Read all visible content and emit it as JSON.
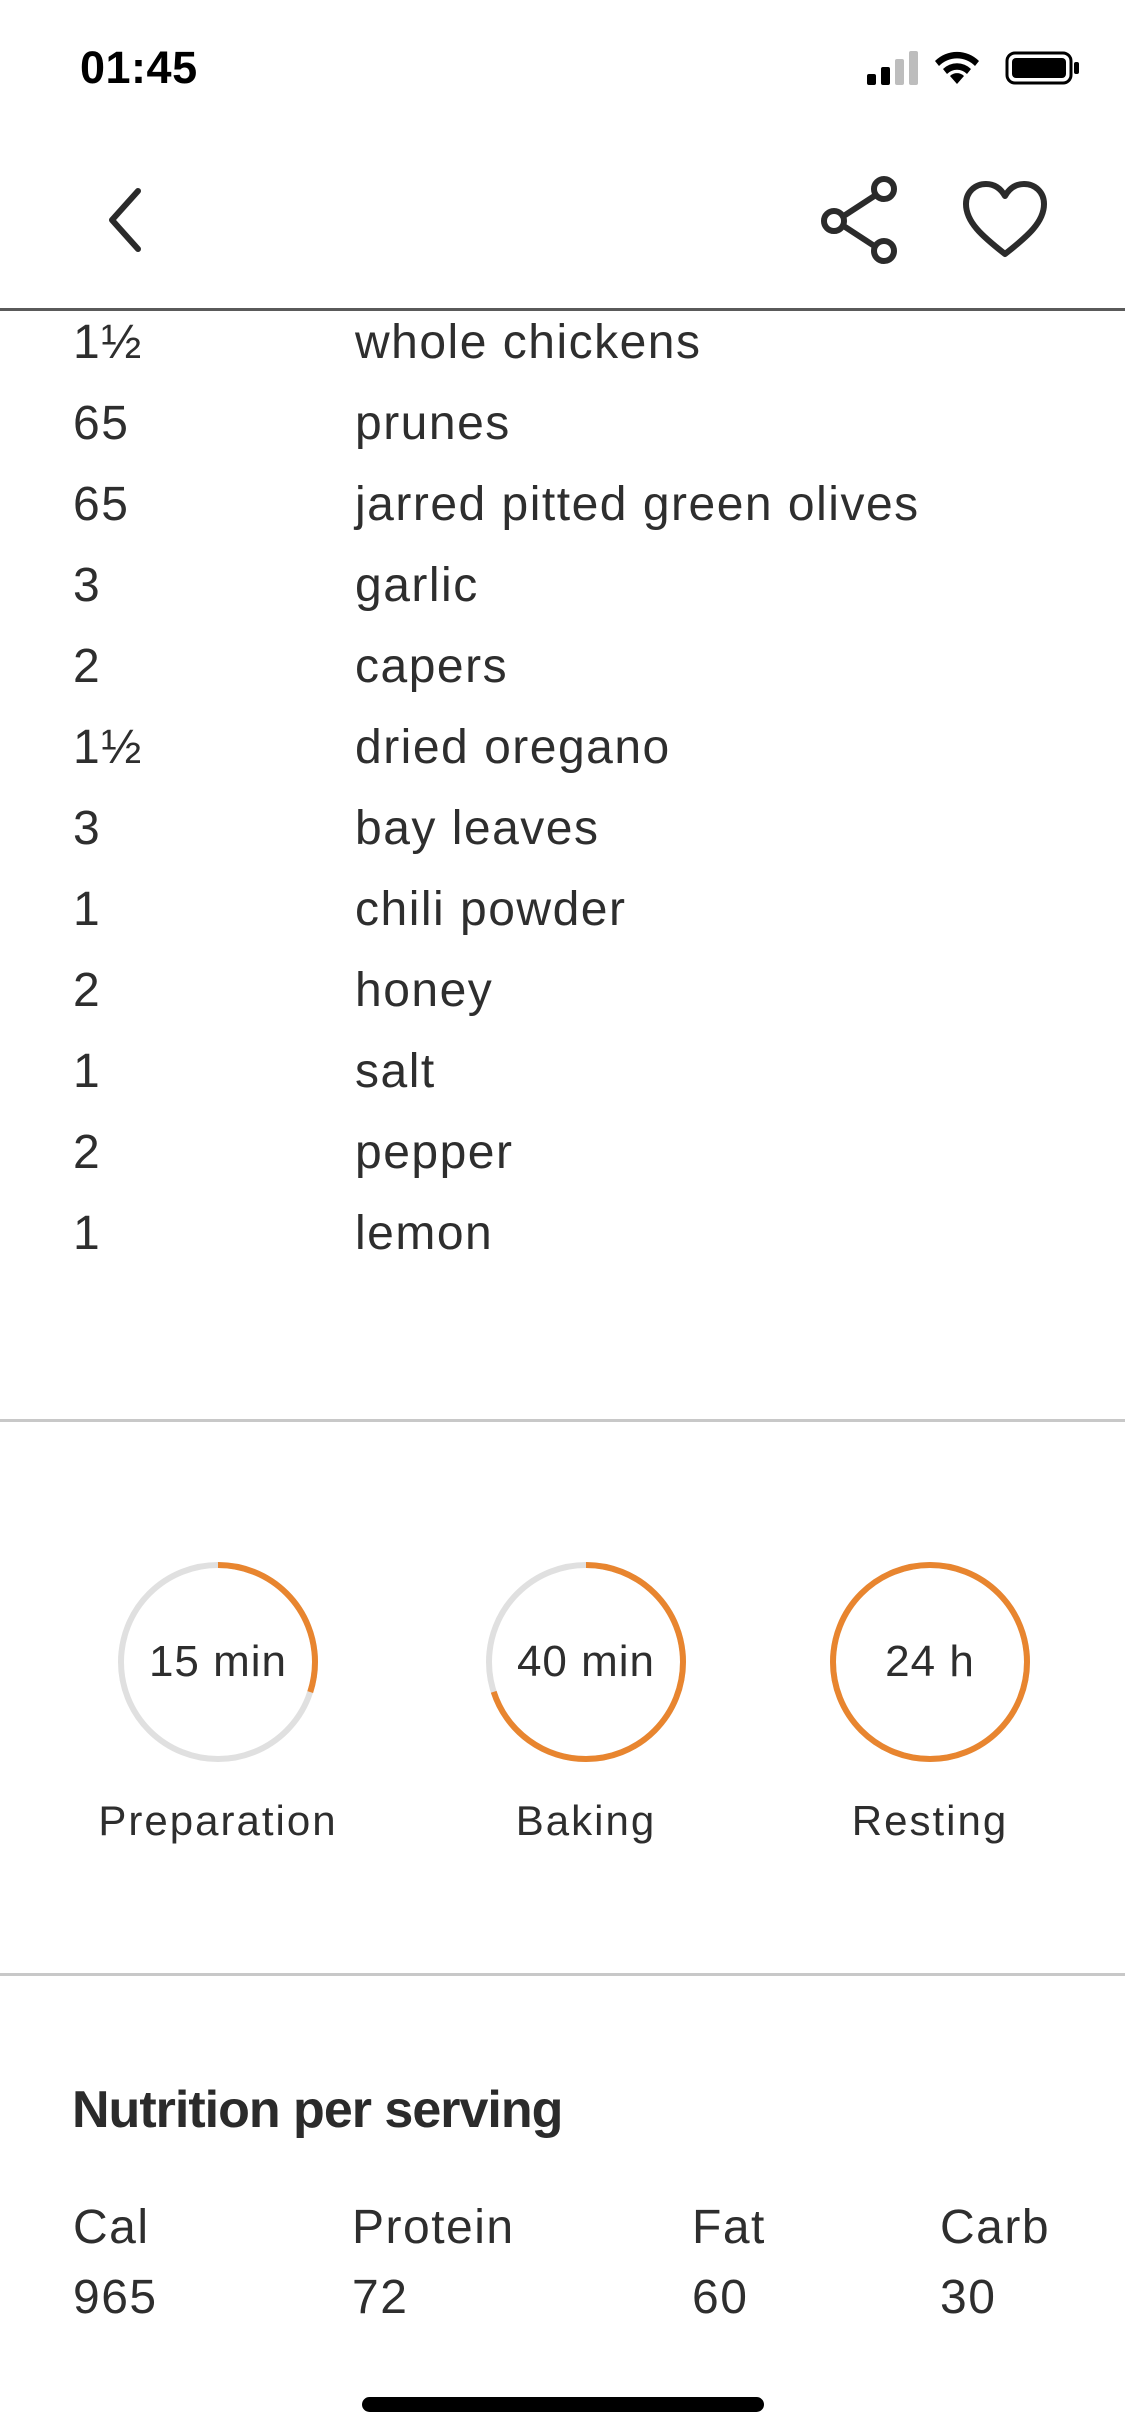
{
  "status_bar": {
    "time": "01:45"
  },
  "ingredients": [
    {
      "qty": "1½",
      "name": "whole chickens"
    },
    {
      "qty": "65",
      "name": "prunes"
    },
    {
      "qty": "65",
      "name": "jarred pitted green olives"
    },
    {
      "qty": "3",
      "name": "garlic"
    },
    {
      "qty": "2",
      "name": "capers"
    },
    {
      "qty": "1½",
      "name": "dried oregano"
    },
    {
      "qty": "3",
      "name": "bay leaves"
    },
    {
      "qty": "1",
      "name": "chili powder"
    },
    {
      "qty": "2",
      "name": "honey"
    },
    {
      "qty": "1",
      "name": "salt"
    },
    {
      "qty": "2",
      "name": "pepper"
    },
    {
      "qty": "1",
      "name": "lemon"
    }
  ],
  "times": [
    {
      "value": "15 min",
      "label": "Preparation",
      "progress": 0.3
    },
    {
      "value": "40 min",
      "label": "Baking",
      "progress": 0.7
    },
    {
      "value": "24 h",
      "label": "Resting",
      "progress": 1.0
    }
  ],
  "nutrition": {
    "title": "Nutrition per serving",
    "items": [
      {
        "label": "Cal",
        "value": "965"
      },
      {
        "label": "Protein",
        "value": "72"
      },
      {
        "label": "Fat",
        "value": "60"
      },
      {
        "label": "Carb",
        "value": "30"
      }
    ]
  },
  "colors": {
    "accent": "#E8852F",
    "track": "#E0E0E0",
    "text": "#2E2E2E",
    "divider": "#C8C8C8"
  },
  "icons": [
    "back-chevron-icon",
    "share-icon",
    "heart-icon",
    "signal-icon",
    "wifi-icon",
    "battery-icon"
  ]
}
